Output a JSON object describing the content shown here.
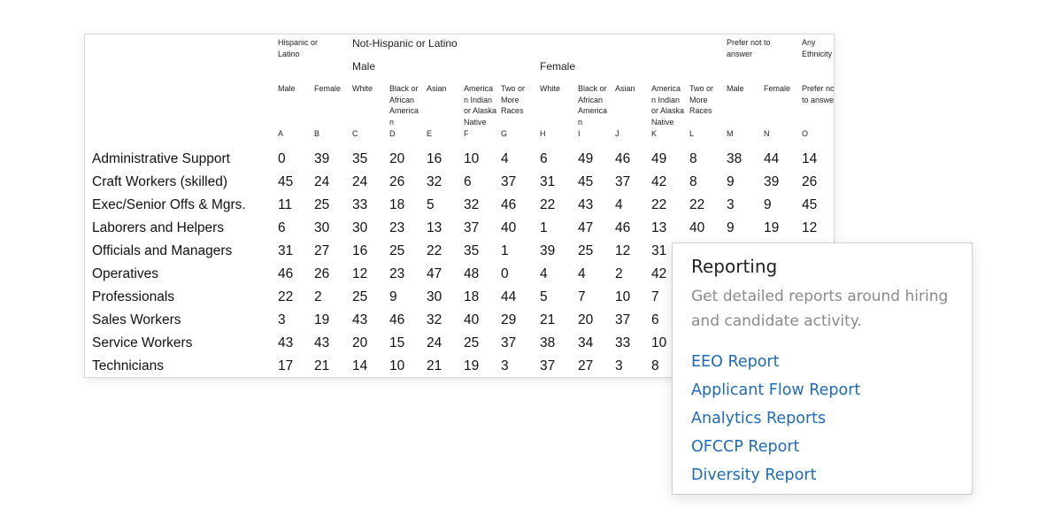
{
  "table": {
    "header": {
      "hispanic": "Hispanic or Latino",
      "not_hispanic": "Not-Hispanic or Latino",
      "male": "Male",
      "female": "Female",
      "prefer_not": "Prefer not to answer",
      "any_ethnicity": "Any Ethnicity"
    },
    "columns": [
      {
        "label": "Male",
        "letter": "A"
      },
      {
        "label": "Female",
        "letter": "B"
      },
      {
        "label": "White",
        "letter": "C"
      },
      {
        "label": "Black or African America n",
        "letter": "D"
      },
      {
        "label": "Asian",
        "letter": "E"
      },
      {
        "label": "America n Indian or Alaska Native",
        "letter": "F"
      },
      {
        "label": "Two or More Races",
        "letter": "G"
      },
      {
        "label": "White",
        "letter": "H"
      },
      {
        "label": "Black or African America n",
        "letter": "I"
      },
      {
        "label": "Asian",
        "letter": "J"
      },
      {
        "label": "America n Indian or Alaska Native",
        "letter": "K"
      },
      {
        "label": "Two or More Races",
        "letter": "L"
      },
      {
        "label": "Male",
        "letter": "M"
      },
      {
        "label": "Female",
        "letter": "N"
      },
      {
        "label": "Prefer not to answer",
        "letter": "O"
      }
    ],
    "rows": [
      {
        "label": "Administrative Support",
        "values": [
          "0",
          "39",
          "35",
          "20",
          "16",
          "10",
          "4",
          "6",
          "49",
          "46",
          "49",
          "8",
          "38",
          "44",
          "14"
        ]
      },
      {
        "label": "Craft Workers (skilled)",
        "values": [
          "45",
          "24",
          "24",
          "26",
          "32",
          "6",
          "37",
          "31",
          "45",
          "37",
          "42",
          "8",
          "9",
          "39",
          "26"
        ]
      },
      {
        "label": "Exec/Senior Offs & Mgrs.",
        "values": [
          "11",
          "25",
          "33",
          "18",
          "5",
          "32",
          "46",
          "22",
          "43",
          "4",
          "22",
          "22",
          "3",
          "9",
          "45"
        ]
      },
      {
        "label": "Laborers and Helpers",
        "values": [
          "6",
          "30",
          "30",
          "23",
          "13",
          "37",
          "40",
          "1",
          "47",
          "46",
          "13",
          "40",
          "9",
          "19",
          "12"
        ]
      },
      {
        "label": "Officials and Managers",
        "values": [
          "31",
          "27",
          "16",
          "25",
          "22",
          "35",
          "1",
          "39",
          "25",
          "12",
          "31",
          "",
          "",
          "",
          ""
        ]
      },
      {
        "label": "Operatives",
        "values": [
          "46",
          "26",
          "12",
          "23",
          "47",
          "48",
          "0",
          "4",
          "4",
          "2",
          "42",
          "",
          "",
          "",
          ""
        ]
      },
      {
        "label": "Professionals",
        "values": [
          "22",
          "2",
          "25",
          "9",
          "30",
          "18",
          "44",
          "5",
          "7",
          "10",
          "7",
          "",
          "",
          "",
          ""
        ]
      },
      {
        "label": "Sales Workers",
        "values": [
          "3",
          "19",
          "43",
          "46",
          "32",
          "40",
          "29",
          "21",
          "20",
          "37",
          "6",
          "",
          "",
          "",
          ""
        ]
      },
      {
        "label": "Service Workers",
        "values": [
          "43",
          "43",
          "20",
          "15",
          "24",
          "25",
          "37",
          "38",
          "34",
          "33",
          "10",
          "",
          "",
          "",
          ""
        ]
      },
      {
        "label": "Technicians",
        "values": [
          "17",
          "21",
          "14",
          "10",
          "21",
          "19",
          "3",
          "37",
          "27",
          "3",
          "8",
          "",
          "",
          "",
          ""
        ]
      }
    ]
  },
  "popup": {
    "title": "Reporting",
    "description": "Get detailed reports around hiring and candidate activity.",
    "links": [
      "EEO Report",
      "Applicant Flow Report",
      "Analytics Reports",
      "OFCCP Report",
      "Diversity Report"
    ]
  }
}
